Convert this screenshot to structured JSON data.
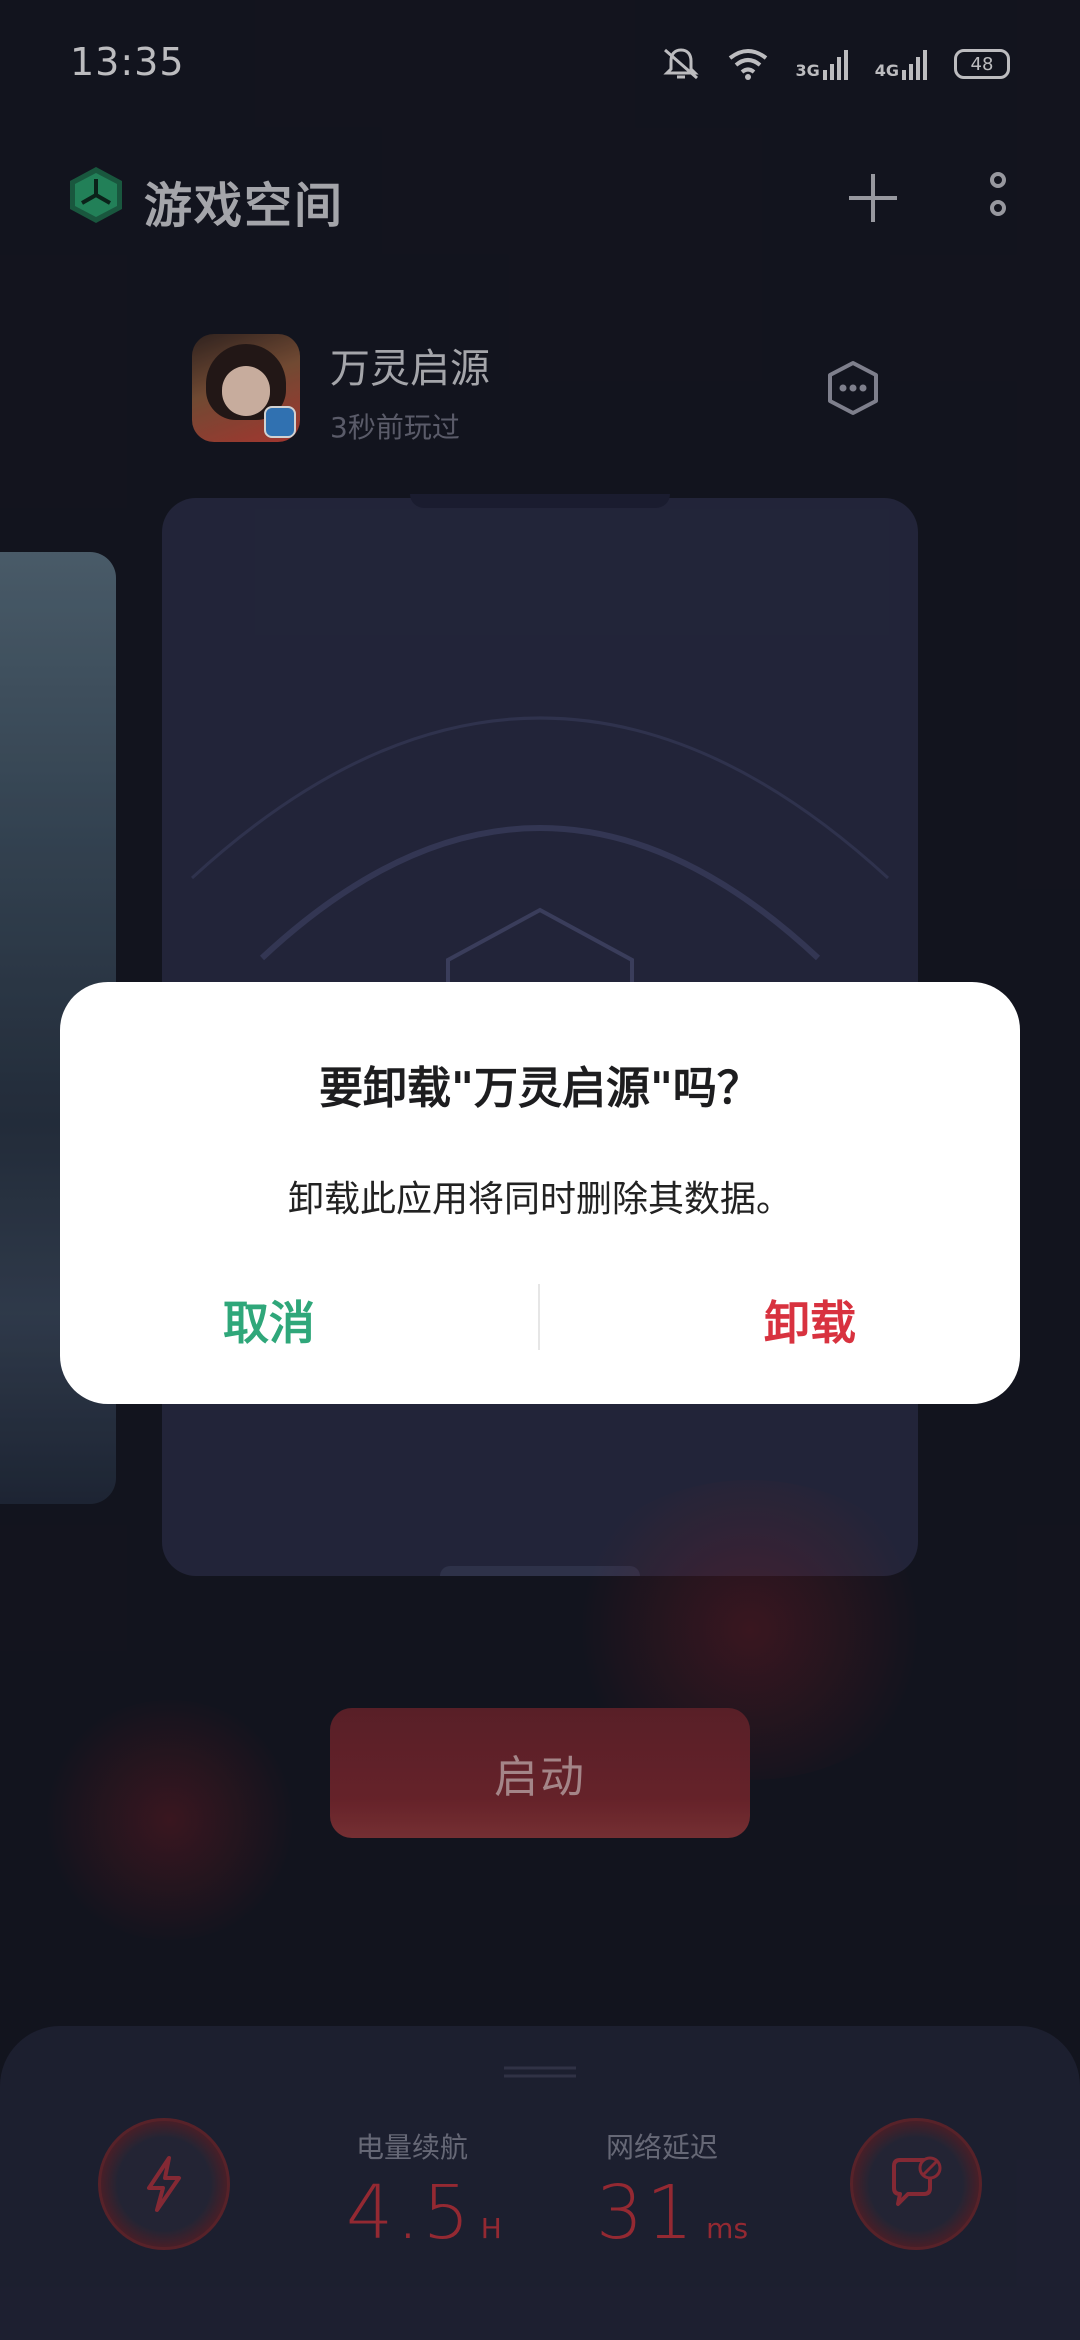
{
  "status_bar": {
    "time": "13:35",
    "icons": [
      "mute-icon",
      "wifi-icon",
      "signal-3g-icon",
      "signal-4g-icon"
    ],
    "net1": "3G",
    "net2": "4G",
    "battery": "48"
  },
  "header": {
    "title": "游戏空间",
    "add_icon": "plus-icon",
    "more_icon": "more-vertical-icon"
  },
  "game": {
    "name": "万灵启源",
    "last_played": "3秒前玩过"
  },
  "launch_label": "启动",
  "stats": {
    "battery_label": "电量续航",
    "battery_value": "4.5",
    "battery_unit": "H",
    "latency_label": "网络延迟",
    "latency_value": "31",
    "latency_unit": "ms"
  },
  "dialog": {
    "title": "要卸载\"万灵启源\"吗？",
    "message": "卸载此应用将同时删除其数据。",
    "cancel": "取消",
    "confirm": "卸载"
  },
  "colors": {
    "background": "#171925",
    "card": "#2a2d46",
    "accent_red": "#b5323e",
    "cancel_green": "#2fa77a",
    "uninstall_red": "#d8323f"
  }
}
